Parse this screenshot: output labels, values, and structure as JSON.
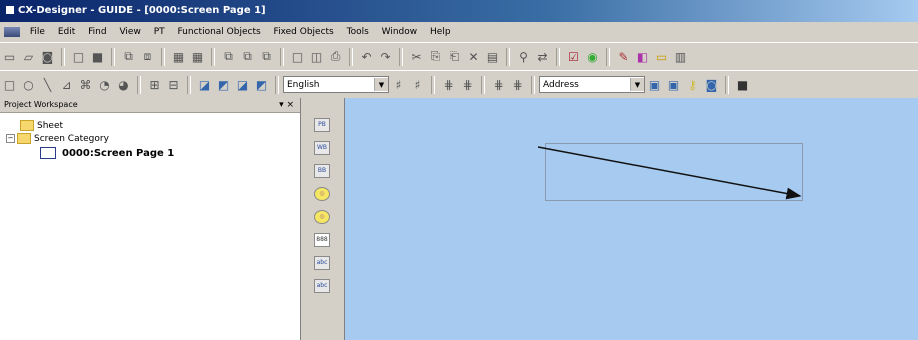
{
  "window": {
    "title": "CX-Designer - GUIDE - [0000:Screen Page 1]"
  },
  "menu": [
    "File",
    "Edit",
    "Find",
    "View",
    "PT",
    "Functional Objects",
    "Fixed Objects",
    "Tools",
    "Window",
    "Help"
  ],
  "toolbar2": {
    "language": "English",
    "address": "Address"
  },
  "workspace": {
    "title": "Project Workspace",
    "controls": "▾ ×",
    "tree": {
      "sheet": "Sheet",
      "category": "Screen Category",
      "page": "0000:Screen Page 1"
    }
  },
  "vertical_tools": [
    "PB",
    "WB",
    "BB",
    "◎",
    "◎",
    "888",
    "abc",
    "abc"
  ]
}
